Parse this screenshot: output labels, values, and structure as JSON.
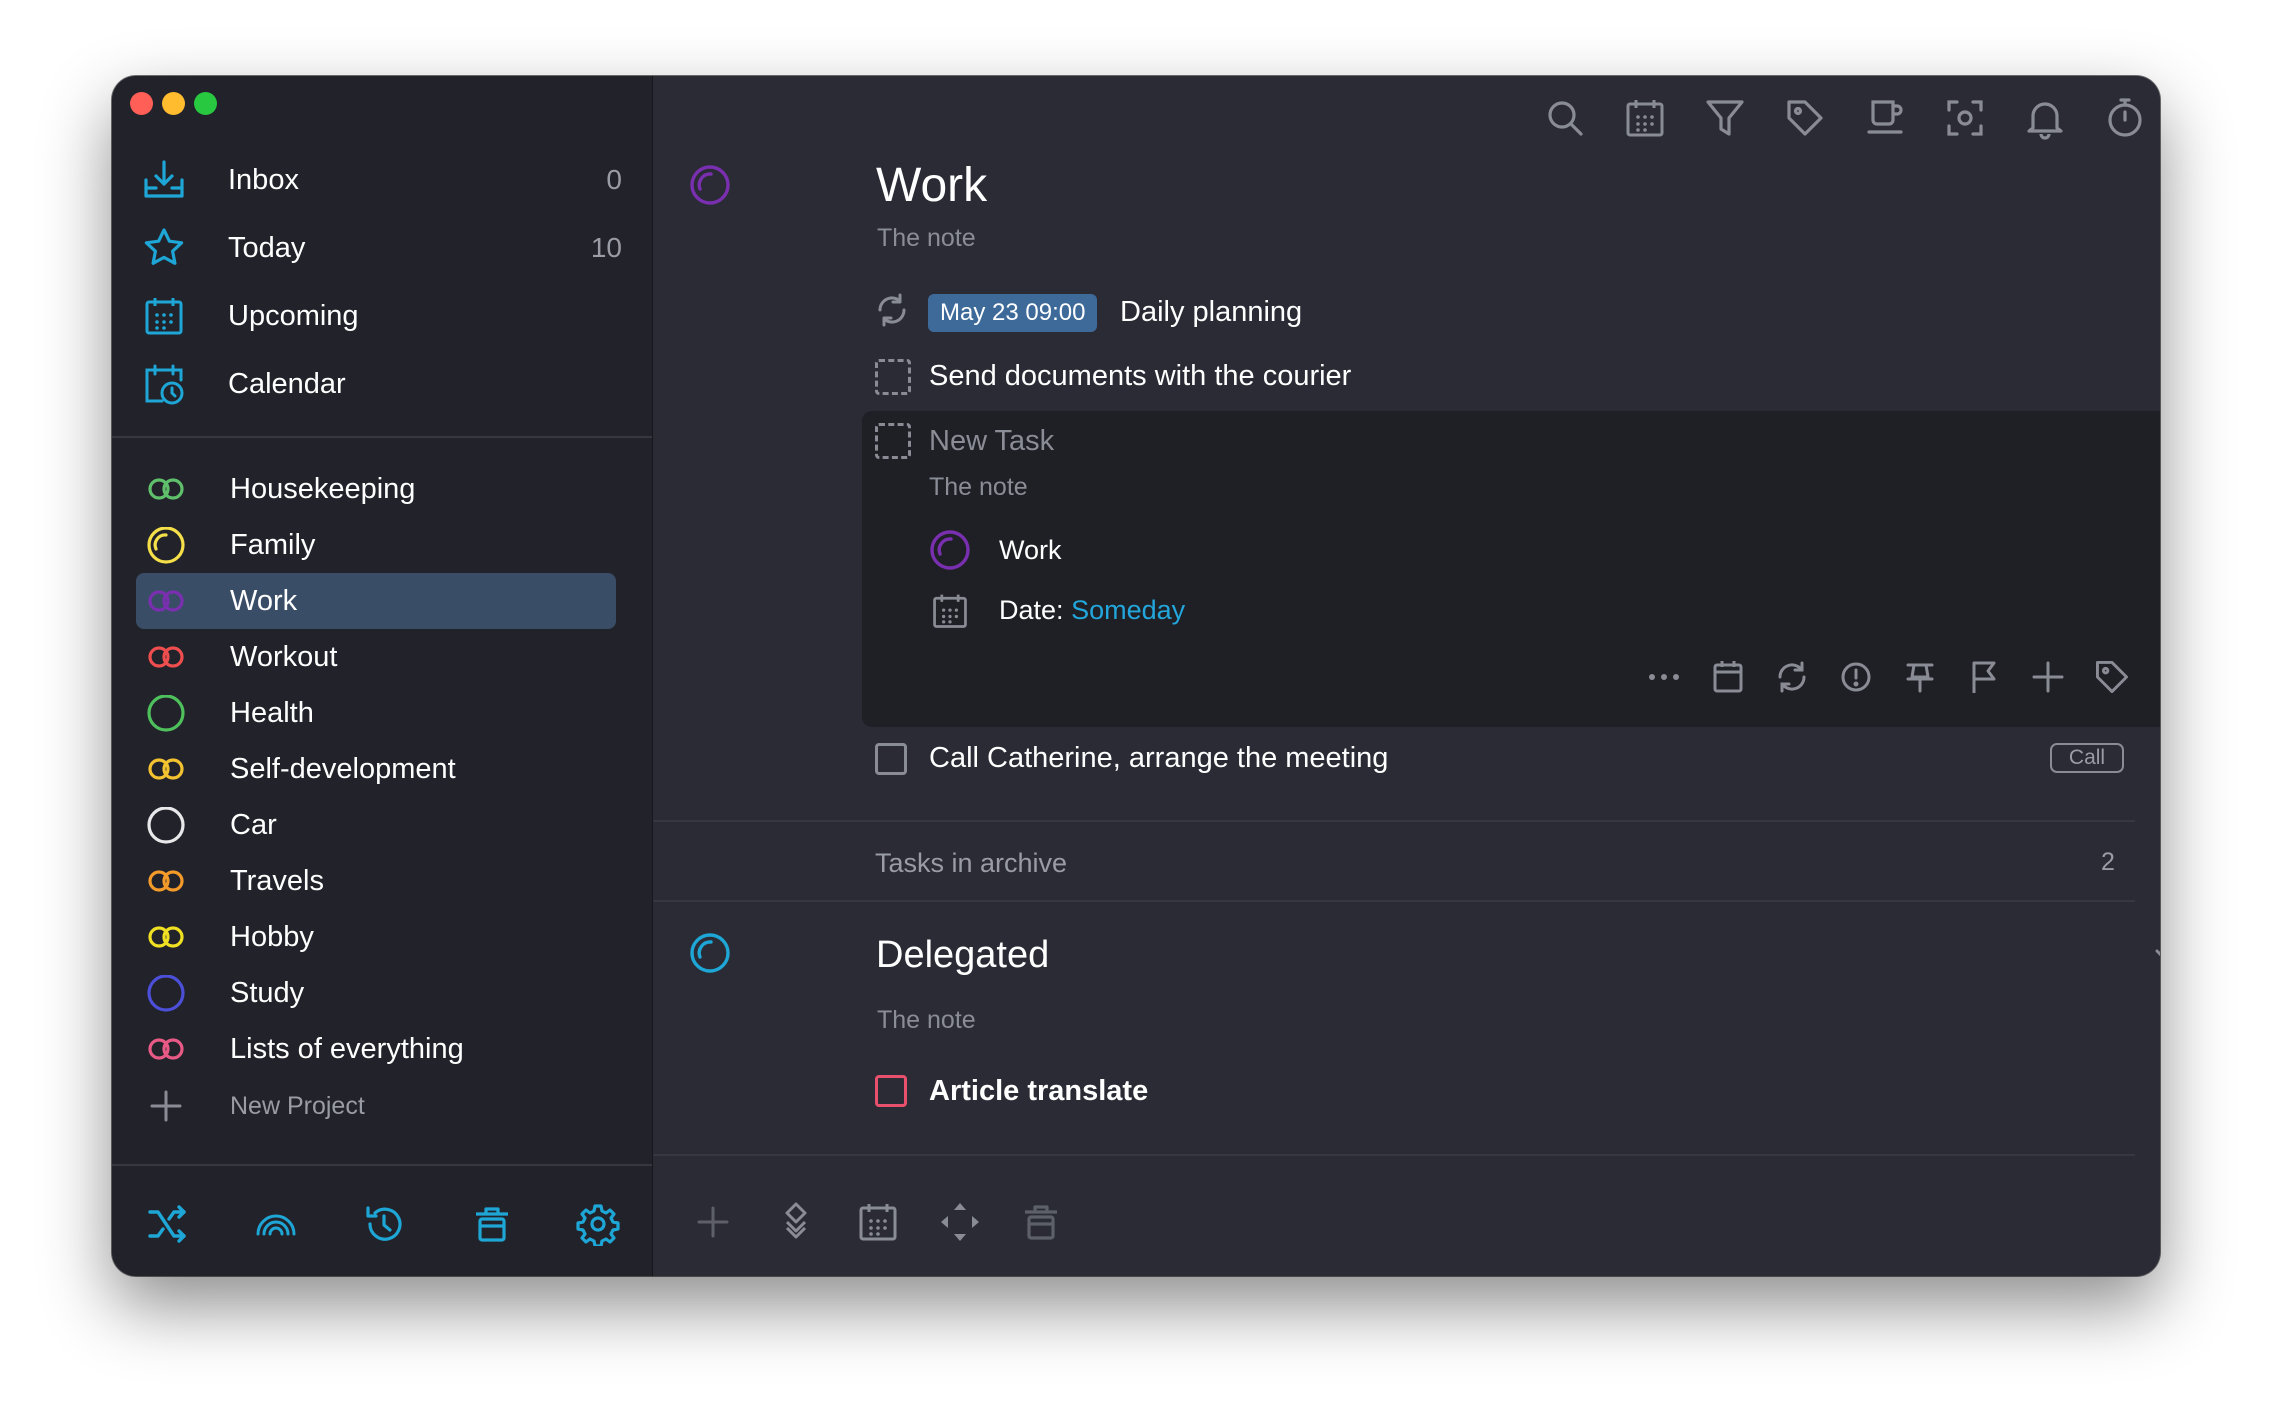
{
  "window": {
    "traffic_lights": [
      "#ff5f57",
      "#febc2e",
      "#28c840"
    ]
  },
  "sidebar": {
    "nav": [
      {
        "label": "Inbox",
        "count": "0",
        "icon": "inbox-icon"
      },
      {
        "label": "Today",
        "count": "10",
        "icon": "star-icon"
      },
      {
        "label": "Upcoming",
        "count": "",
        "icon": "calendar-grid-icon"
      },
      {
        "label": "Calendar",
        "count": "",
        "icon": "calendar-clock-icon"
      }
    ],
    "projects": [
      {
        "label": "Housekeeping",
        "color": "#5fbf6a",
        "icon": "linked-rings-icon"
      },
      {
        "label": "Family",
        "color": "#f5e04a",
        "icon": "progress-circle-icon"
      },
      {
        "label": "Work",
        "color": "#7a2fb0",
        "icon": "linked-rings-icon"
      },
      {
        "label": "Workout",
        "color": "#ef4e4e",
        "icon": "linked-rings-icon"
      },
      {
        "label": "Health",
        "color": "#4fc15c",
        "icon": "circle-icon"
      },
      {
        "label": "Self-development",
        "color": "#f2c230",
        "icon": "linked-rings-icon"
      },
      {
        "label": "Car",
        "color": "#e8e8ea",
        "icon": "circle-icon"
      },
      {
        "label": "Travels",
        "color": "#f39a2a",
        "icon": "linked-rings-icon"
      },
      {
        "label": "Hobby",
        "color": "#f0e023",
        "icon": "linked-rings-icon"
      },
      {
        "label": "Study",
        "color": "#4c4fd8",
        "icon": "circle-icon"
      },
      {
        "label": "Lists of everything",
        "color": "#e85a86",
        "icon": "linked-rings-icon"
      }
    ],
    "selected_project": "Work",
    "new_project_label": "New Project",
    "footer_icons": [
      "shuffle-icon",
      "rainbow-icon",
      "history-icon",
      "trash-icon",
      "settings-gear-icon"
    ]
  },
  "toolbar": {
    "icons": [
      "search-icon",
      "calendar-grid-icon",
      "filter-icon",
      "tag-icon",
      "coffee-cup-icon",
      "focus-icon",
      "bell-icon",
      "timer-icon",
      "copy-windows-icon"
    ]
  },
  "main": {
    "project_title": "Work",
    "project_note": "The note",
    "tasks": [
      {
        "type": "recurring",
        "date_badge": "May 23 09:00",
        "title": "Daily planning"
      },
      {
        "type": "dashed",
        "title": "Send documents with the courier"
      }
    ],
    "editor": {
      "title_placeholder": "New Task",
      "note": "The note",
      "project_label": "Work",
      "date_label": "Date:",
      "date_value": "Someday",
      "actions": [
        "more-icon",
        "calendar-icon",
        "repeat-icon",
        "priority-icon",
        "pin-icon",
        "flag-icon",
        "add-icon",
        "tag-icon",
        "checklist-icon"
      ]
    },
    "task_call": {
      "title": "Call Catherine, arrange the meeting",
      "tag": "Call"
    },
    "archive": {
      "label": "Tasks in archive",
      "count": "2"
    },
    "section": {
      "title": "Delegated",
      "note": "The note",
      "task": "Article translate"
    },
    "bottom_icons": [
      "add-icon",
      "move-icon",
      "calendar-grid-icon",
      "arrows-icon",
      "trash-icon"
    ],
    "cloud_icon": "cloud-icon"
  },
  "colors": {
    "accent": "#1ea7d6",
    "sidebar_selected": "#3a4d66",
    "date_badge_bg": "#3d6a99",
    "link": "#22a6dc"
  }
}
